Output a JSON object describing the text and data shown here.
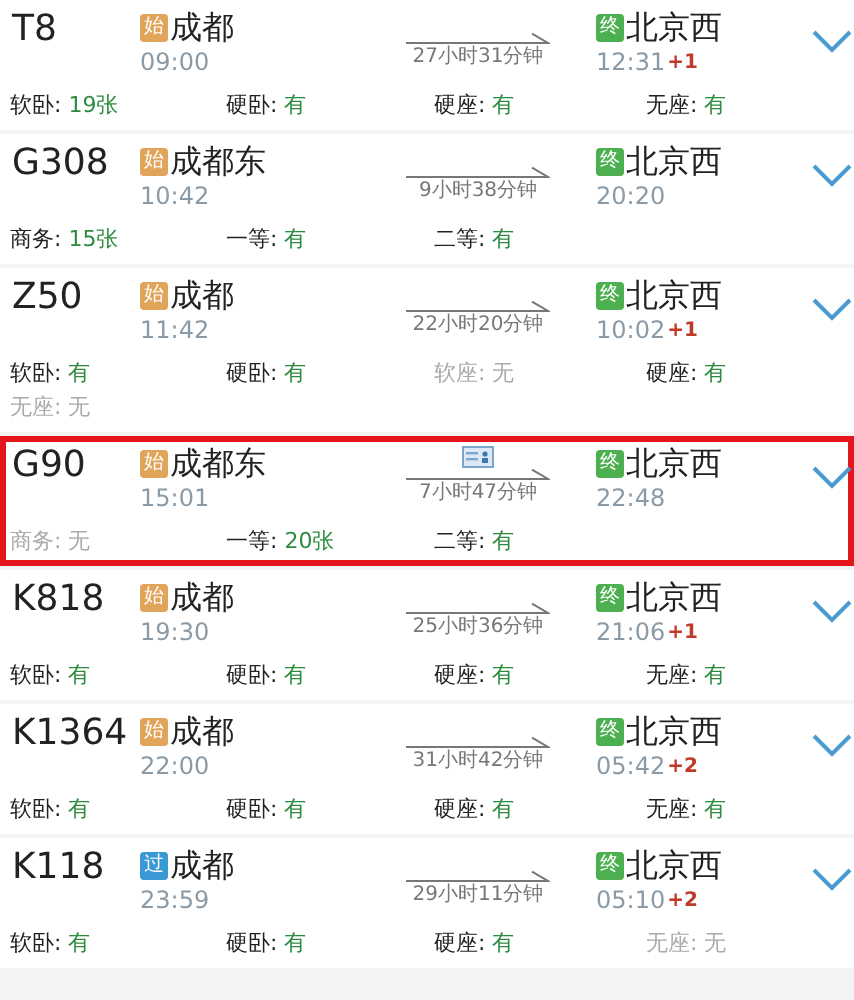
{
  "trains": [
    {
      "number": "T8",
      "highlighted": false,
      "ticket_icon": false,
      "origin": {
        "kind": "start",
        "badge": "始",
        "station": "成都",
        "time": "09:00"
      },
      "duration": "27小时31分钟",
      "destination": {
        "kind": "end",
        "badge": "终",
        "station": "北京西",
        "time": "12:31",
        "day_offset": "+1"
      },
      "seats": [
        {
          "label": "软卧:",
          "value": "19张",
          "available": true
        },
        {
          "label": "硬卧:",
          "value": "有",
          "available": true
        },
        {
          "label": "硬座:",
          "value": "有",
          "available": true
        },
        {
          "label": "无座:",
          "value": "有",
          "available": true
        }
      ]
    },
    {
      "number": "G308",
      "highlighted": false,
      "ticket_icon": false,
      "origin": {
        "kind": "start",
        "badge": "始",
        "station": "成都东",
        "time": "10:42"
      },
      "duration": "9小时38分钟",
      "destination": {
        "kind": "end",
        "badge": "终",
        "station": "北京西",
        "time": "20:20"
      },
      "seats": [
        {
          "label": "商务:",
          "value": "15张",
          "available": true
        },
        {
          "label": "一等:",
          "value": "有",
          "available": true
        },
        {
          "label": "二等:",
          "value": "有",
          "available": true
        }
      ]
    },
    {
      "number": "Z50",
      "highlighted": false,
      "ticket_icon": false,
      "origin": {
        "kind": "start",
        "badge": "始",
        "station": "成都",
        "time": "11:42"
      },
      "duration": "22小时20分钟",
      "destination": {
        "kind": "end",
        "badge": "终",
        "station": "北京西",
        "time": "10:02",
        "day_offset": "+1"
      },
      "seats": [
        {
          "label": "软卧:",
          "value": "有",
          "available": true
        },
        {
          "label": "硬卧:",
          "value": "有",
          "available": true
        },
        {
          "label": "软座:",
          "value": "无",
          "available": false
        },
        {
          "label": "硬座:",
          "value": "有",
          "available": true
        },
        {
          "label": "无座:",
          "value": "无",
          "available": false
        }
      ]
    },
    {
      "number": "G90",
      "highlighted": true,
      "ticket_icon": true,
      "origin": {
        "kind": "start",
        "badge": "始",
        "station": "成都东",
        "time": "15:01"
      },
      "duration": "7小时47分钟",
      "destination": {
        "kind": "end",
        "badge": "终",
        "station": "北京西",
        "time": "22:48"
      },
      "seats": [
        {
          "label": "商务:",
          "value": "无",
          "available": false
        },
        {
          "label": "一等:",
          "value": "20张",
          "available": true
        },
        {
          "label": "二等:",
          "value": "有",
          "available": true
        }
      ]
    },
    {
      "number": "K818",
      "highlighted": false,
      "ticket_icon": false,
      "origin": {
        "kind": "start",
        "badge": "始",
        "station": "成都",
        "time": "19:30"
      },
      "duration": "25小时36分钟",
      "destination": {
        "kind": "end",
        "badge": "终",
        "station": "北京西",
        "time": "21:06",
        "day_offset": "+1"
      },
      "seats": [
        {
          "label": "软卧:",
          "value": "有",
          "available": true
        },
        {
          "label": "硬卧:",
          "value": "有",
          "available": true
        },
        {
          "label": "硬座:",
          "value": "有",
          "available": true
        },
        {
          "label": "无座:",
          "value": "有",
          "available": true
        }
      ]
    },
    {
      "number": "K1364",
      "highlighted": false,
      "ticket_icon": false,
      "origin": {
        "kind": "start",
        "badge": "始",
        "station": "成都",
        "time": "22:00"
      },
      "duration": "31小时42分钟",
      "destination": {
        "kind": "end",
        "badge": "终",
        "station": "北京西",
        "time": "05:42",
        "day_offset": "+2"
      },
      "seats": [
        {
          "label": "软卧:",
          "value": "有",
          "available": true
        },
        {
          "label": "硬卧:",
          "value": "有",
          "available": true
        },
        {
          "label": "硬座:",
          "value": "有",
          "available": true
        },
        {
          "label": "无座:",
          "value": "有",
          "available": true
        }
      ]
    },
    {
      "number": "K118",
      "highlighted": false,
      "ticket_icon": false,
      "origin": {
        "kind": "pass",
        "badge": "过",
        "station": "成都",
        "time": "23:59"
      },
      "duration": "29小时11分钟",
      "destination": {
        "kind": "end",
        "badge": "终",
        "station": "北京西",
        "time": "05:10",
        "day_offset": "+2"
      },
      "seats": [
        {
          "label": "软卧:",
          "value": "有",
          "available": true
        },
        {
          "label": "硬卧:",
          "value": "有",
          "available": true
        },
        {
          "label": "硬座:",
          "value": "有",
          "available": true
        },
        {
          "label": "无座:",
          "value": "无",
          "available": false
        }
      ]
    }
  ]
}
